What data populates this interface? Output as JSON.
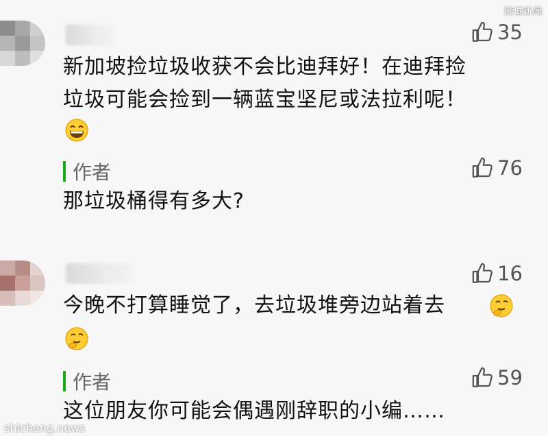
{
  "watermark_top": "狮城新闻",
  "watermark_bottom": "shicheng.news",
  "comments": [
    {
      "likes": "35",
      "text_line1": "新加坡捡垃圾收获不会比迪拜好！在迪拜捡",
      "text_line2": "垃圾可能会捡到一辆蓝宝坚尼或法拉利呢！",
      "emoji": "grinning-face-emoji",
      "reply": {
        "author_label": "作者",
        "likes": "76",
        "text": "那垃圾桶得有多大?"
      }
    },
    {
      "likes": "16",
      "text_line1": "今晚不打算睡觉了，去垃圾堆旁边站着去",
      "emoji": "thinking-face-emoji",
      "reply": {
        "author_label": "作者",
        "likes": "59",
        "text": "这位朋友你可能会偶遇刚辞职的小编……"
      }
    }
  ],
  "colors": {
    "background": "#f7f7f7",
    "author_bar": "#1aad19",
    "like_icon": "#555555"
  }
}
